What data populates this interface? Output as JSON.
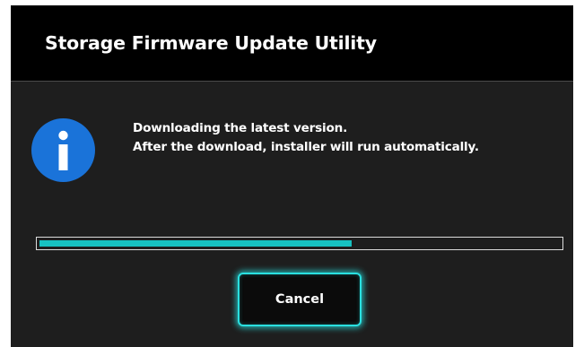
{
  "window": {
    "title": "Storage Firmware Update Utility"
  },
  "message": {
    "line1": "Downloading the latest version.",
    "line2": "After the download, installer will run automatically."
  },
  "icon": {
    "name": "info-icon",
    "color": "#1a73d9"
  },
  "progress": {
    "fraction": 0.6,
    "fill_color": "#17c1c1"
  },
  "buttons": {
    "cancel_label": "Cancel",
    "accent_color": "#2ae0e0"
  }
}
